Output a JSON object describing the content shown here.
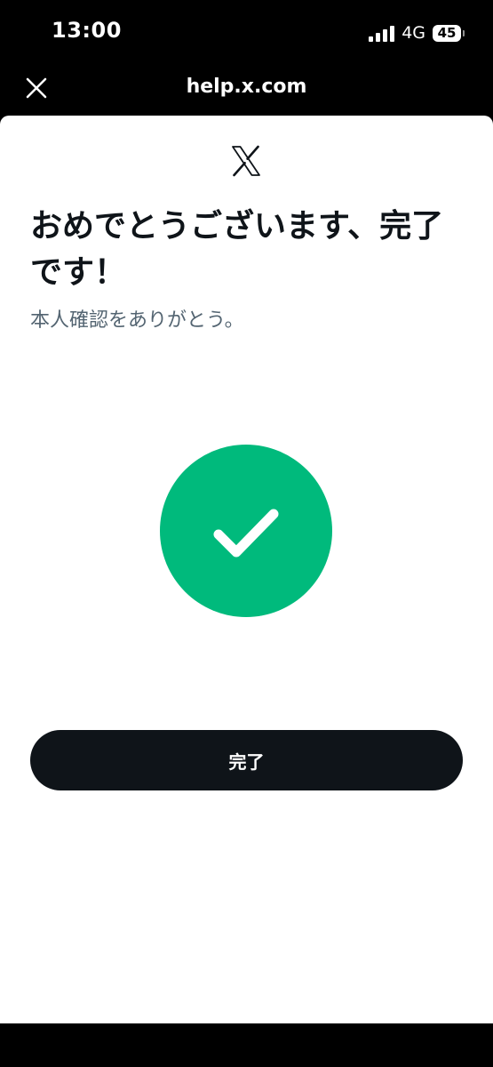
{
  "status_bar": {
    "time": "13:00",
    "network": "4G",
    "battery": "45"
  },
  "browser": {
    "title": "help.x.com",
    "close_icon": "close-icon"
  },
  "content": {
    "logo_icon": "x-logo-icon",
    "headline": "おめでとうございます、完了です！",
    "subtext": "本人確認をありがとう。",
    "success_icon": "checkmark-icon",
    "success_color": "#00ba7c",
    "done_label": "完了"
  }
}
